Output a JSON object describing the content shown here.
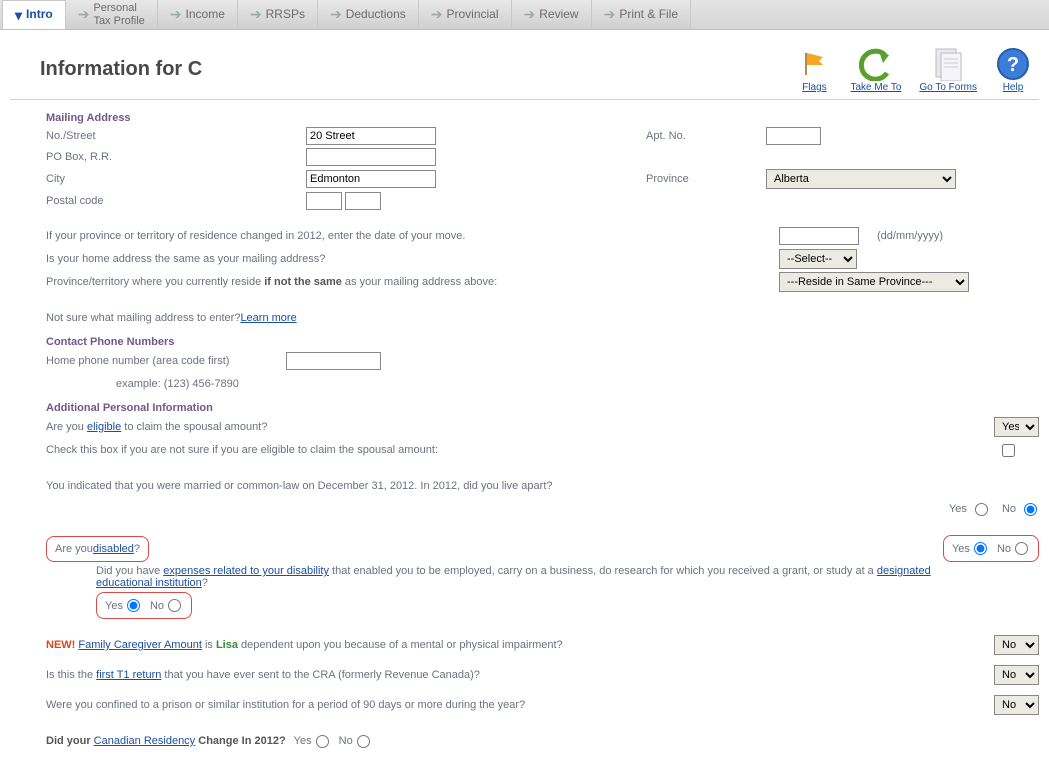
{
  "tabs": [
    {
      "label": "Intro",
      "active": true
    },
    {
      "label": "Personal\nTax Profile"
    },
    {
      "label": "Income"
    },
    {
      "label": "RRSPs"
    },
    {
      "label": "Deductions"
    },
    {
      "label": "Provincial"
    },
    {
      "label": "Review"
    },
    {
      "label": "Print & File"
    }
  ],
  "page_title": "Information for C",
  "toolbar": {
    "flags": "Flags",
    "take_me_to": "Take Me To",
    "go_to_forms": "Go To Forms",
    "help": "Help"
  },
  "mailing": {
    "header": "Mailing Address",
    "no_street_label": "No./Street",
    "no_street_value": "20 Street",
    "apt_label": "Apt. No.",
    "apt_value": "",
    "pobox_label": "PO Box, R.R.",
    "pobox_value": "",
    "city_label": "City",
    "city_value": "Edmonton",
    "province_label": "Province",
    "province_value": "Alberta",
    "postal_label": "Postal code",
    "postal_value": ""
  },
  "move": {
    "text": "If your province or territory of residence changed in 2012, enter the date of your move.",
    "date_value": "",
    "date_hint": "(dd/mm/yyyy)",
    "same_addr": "Is your home address the same as your mailing address?",
    "same_addr_value": "--Select--",
    "reside_prefix": "Province/territory where you currently reside ",
    "reside_bold": "if not the same",
    "reside_suffix": " as your mailing address above:",
    "reside_value": "---Reside in Same Province---",
    "not_sure": "Not sure what mailing address to enter? ",
    "learn_more": "Learn more"
  },
  "phone": {
    "header": "Contact Phone Numbers",
    "home_label": "Home phone number (area code first)",
    "home_value": "",
    "example": "example: (123) 456-7890"
  },
  "addl": {
    "header": "Additional Personal Information",
    "eligible_prefix": "Are you ",
    "eligible_link": "eligible",
    "eligible_suffix": " to claim the spousal amount?",
    "eligible_value": "Yes",
    "check_box": "Check this box if you are not sure if you are eligible to claim the spousal amount:",
    "married_text": "You indicated that you were married or common-law on December 31, 2012. In 2012, did you live apart?",
    "yes": "Yes",
    "no": "No",
    "disabled_prefix": "Are you ",
    "disabled_link": "disabled",
    "disabled_suffix": "?",
    "expense_prefix": "Did you have ",
    "expense_link": "expenses related to your disability",
    "expense_mid": " that enabled you to be employed, carry on a business, do research for which you received a grant, or study at a ",
    "edu_link": "designated educational institution",
    "expense_suffix": "?",
    "new_label": "NEW!",
    "fca_link": "Family Caregiver Amount",
    "fca_mid": " is ",
    "fca_name": "Lisa",
    "fca_suffix": " dependent upon you because of a mental or physical impairment?",
    "fca_value": "No",
    "first_t1_prefix": "Is this the ",
    "first_t1_link": "first T1 return",
    "first_t1_suffix": " that you have ever sent to the CRA (formerly Revenue Canada)?",
    "first_t1_value": "No",
    "prison": "Were you confined to a prison or similar institution for a period of 90 days or more during the year?",
    "prison_value": "No",
    "residency_prefix": "Did your ",
    "residency_link": "Canadian Residency",
    "residency_suffix": " Change In 2012?"
  }
}
